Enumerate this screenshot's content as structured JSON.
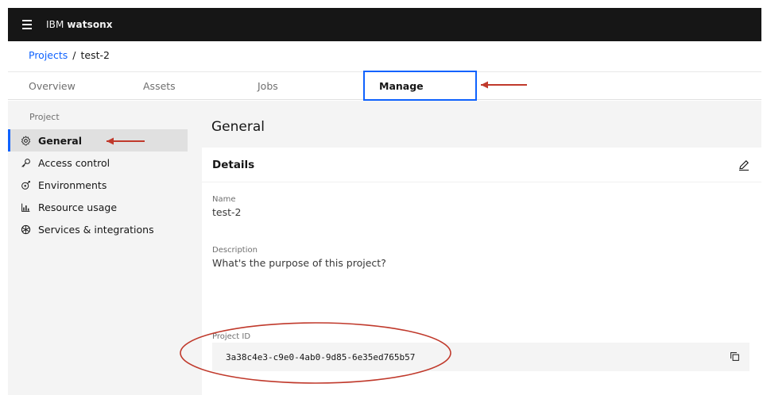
{
  "header": {
    "product_prefix": "IBM",
    "product_name": "watsonx",
    "menu_icon": "hamburger-menu-icon"
  },
  "breadcrumb": {
    "parent": "Projects",
    "separator": "/",
    "current": "test-2"
  },
  "tabs": [
    {
      "label": "Overview"
    },
    {
      "label": "Assets"
    },
    {
      "label": "Jobs"
    },
    {
      "label": "Manage",
      "selected": true
    }
  ],
  "sidebar": {
    "heading": "Project",
    "items": [
      {
        "label": "General",
        "icon": "gear-icon",
        "active": true
      },
      {
        "label": "Access control",
        "icon": "key-icon"
      },
      {
        "label": "Environments",
        "icon": "environment-icon"
      },
      {
        "label": "Resource usage",
        "icon": "bar-chart-icon"
      },
      {
        "label": "Services & integrations",
        "icon": "services-icon"
      }
    ]
  },
  "main": {
    "title": "General",
    "details": {
      "title": "Details",
      "edit_icon": "edit-icon",
      "name_label": "Name",
      "name_value": "test-2",
      "description_label": "Description",
      "description_value": "What's the purpose of this project?",
      "project_id_label": "Project ID",
      "project_id_value": "3a38c4e3-c9e0-4ab0-9d85-6e35ed765b57",
      "copy_icon": "copy-icon"
    }
  },
  "colors": {
    "accent": "#0f62fe",
    "header_bg": "#161616",
    "annotation": "#c0392b",
    "panel_bg": "#f4f4f4"
  }
}
